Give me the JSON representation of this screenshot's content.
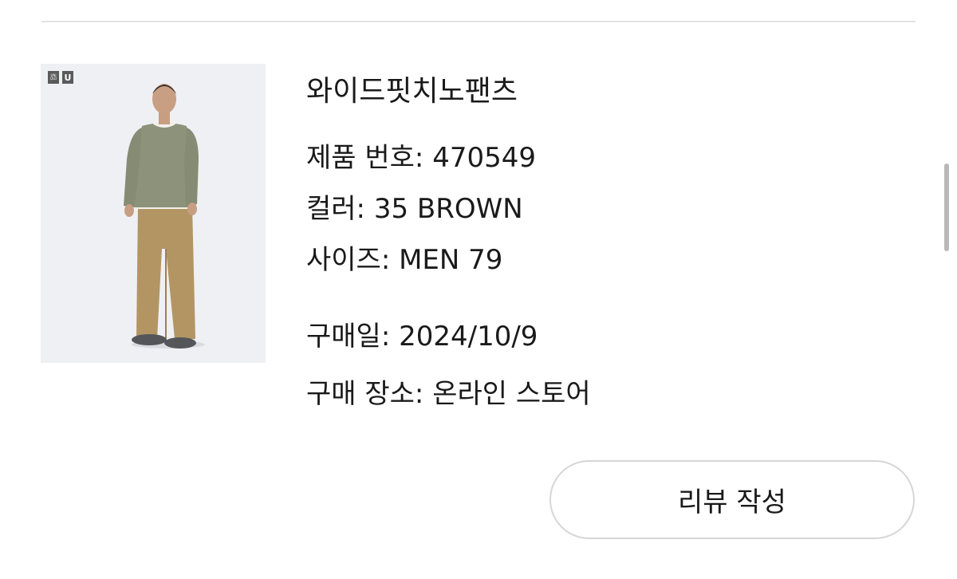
{
  "product": {
    "brand_logo_text": "UNI\nQLO",
    "brand_logo_u": "U",
    "name": "와이드핏치노팬츠",
    "product_number": "제품 번호: 470549",
    "color": "컬러: 35 BROWN",
    "size": "사이즈: MEN 79",
    "purchase_date": "구매일: 2024/10/9",
    "purchase_place": "구매 장소: 온라인 스토어"
  },
  "actions": {
    "review_button_label": "리뷰 작성"
  },
  "colors": {
    "button_border": "#d6d6d6",
    "divider": "#e3e3e3",
    "image_background": "#eef0f4",
    "pants": "#b39564",
    "sweater": "#8d927b"
  },
  "icons": {
    "brand": "uniqlo-logo-icon",
    "sub_brand": "uniqlo-u-logo-icon"
  }
}
